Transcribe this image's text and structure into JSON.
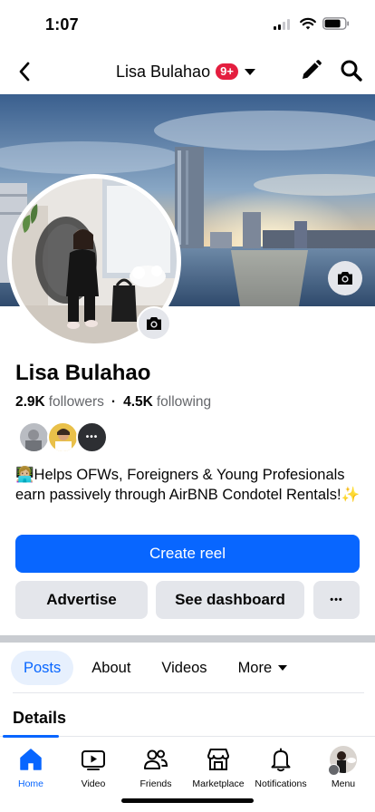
{
  "status_bar": {
    "time": "1:07"
  },
  "nav": {
    "title": "Lisa Bulahao",
    "badge": "9+"
  },
  "profile": {
    "name": "Lisa Bulahao",
    "followers_count": "2.9K",
    "followers_label": "followers",
    "following_count": "4.5K",
    "following_label": "following",
    "bio_emoji": "👩🏼‍💻",
    "bio_text": "Helps OFWs, Foreigners & Young Profesionals earn passively through AirBNB Condotel Rentals!✨",
    "friends_more": "•••"
  },
  "actions": {
    "create_reel": "Create reel",
    "advertise": "Advertise",
    "see_dashboard": "See dashboard",
    "more": "•••"
  },
  "tabs": [
    {
      "label": "Posts",
      "active": true
    },
    {
      "label": "About"
    },
    {
      "label": "Videos"
    },
    {
      "label": "More"
    }
  ],
  "details": {
    "title": "Details"
  },
  "bottom_nav": [
    {
      "label": "Home",
      "icon": "home-icon",
      "active": true
    },
    {
      "label": "Video",
      "icon": "video-icon"
    },
    {
      "label": "Friends",
      "icon": "friends-icon"
    },
    {
      "label": "Marketplace",
      "icon": "marketplace-icon"
    },
    {
      "label": "Notifications",
      "icon": "bell-icon"
    },
    {
      "label": "Menu",
      "icon": "profile-avatar"
    }
  ],
  "colors": {
    "brand_blue": "#0866ff",
    "badge_red": "#e41e3f",
    "secondary_button": "#e4e6eb",
    "active_tab_bg": "#e7f0fd",
    "text": "#050505",
    "muted": "#65676b"
  }
}
